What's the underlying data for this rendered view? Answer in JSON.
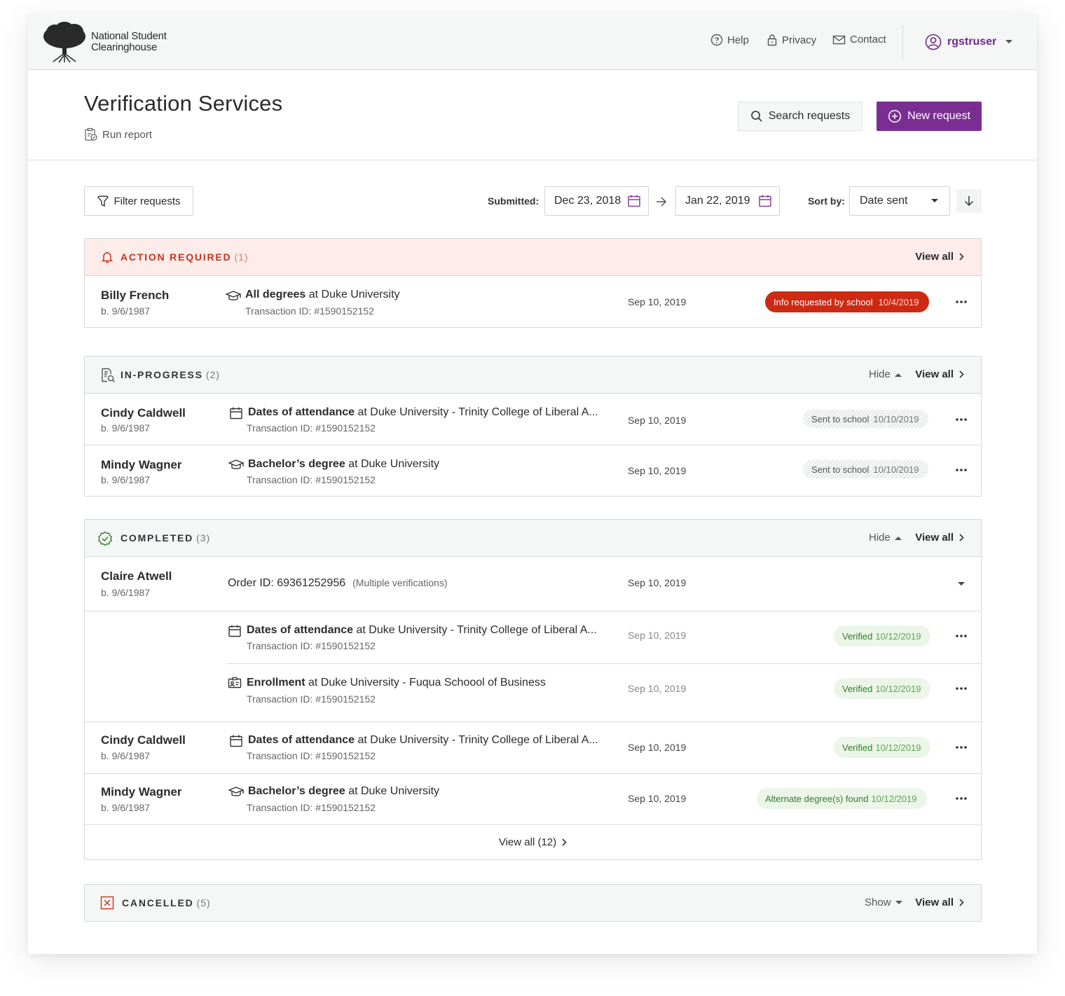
{
  "brand": {
    "name_line1": "National Student",
    "name_line2": "Clearinghouse"
  },
  "nav": {
    "help": "Help",
    "privacy": "Privacy",
    "contact": "Contact",
    "username": "rgstruser"
  },
  "page": {
    "title": "Verification Services",
    "run_report": "Run report",
    "search_button": "Search requests",
    "new_button": "New request"
  },
  "filters": {
    "filter_button": "Filter requests",
    "submitted_label": "Submitted:",
    "date_from": "Dec 23, 2018",
    "date_to": "Jan 22, 2019",
    "sort_label": "Sort by:",
    "sort_value": "Date sent"
  },
  "colors": {
    "brand_purple": "#7b2e91",
    "alert_red": "#cc2a12",
    "verified_green": "#2f7d2a"
  },
  "sections": {
    "action": {
      "title": "ACTION REQUIRED",
      "count": "(1)",
      "view_all": "View all",
      "rows": [
        {
          "name": "Billy French",
          "dob": "b. 9/6/1987",
          "icon": "graduation-cap-icon",
          "type": "All degrees",
          "at": "at Duke University",
          "transaction": "Transaction ID: #1590152152",
          "date": "Sep 10, 2019",
          "status": "Info requested by school",
          "status_date": "10/4/2019"
        }
      ]
    },
    "inprogress": {
      "title": "IN-PROGRESS",
      "count": "(2)",
      "hide": "Hide",
      "view_all": "View all",
      "rows": [
        {
          "name": "Cindy Caldwell",
          "dob": "b. 9/6/1987",
          "icon": "calendar-icon",
          "type": "Dates of attendance",
          "at": "at Duke University - Trinity College of Liberal A...",
          "transaction": "Transaction ID: #1590152152",
          "date": "Sep 10, 2019",
          "status": "Sent to school",
          "status_date": "10/10/2019"
        },
        {
          "name": "Mindy Wagner",
          "dob": "b. 9/6/1987",
          "icon": "graduation-cap-icon",
          "type": "Bachelor’s degree",
          "at": "at Duke University",
          "transaction": "Transaction ID: #1590152152",
          "date": "Sep 10, 2019",
          "status": "Sent to school",
          "status_date": "10/10/2019"
        }
      ]
    },
    "completed": {
      "title": "COMPLETED",
      "count": "(3)",
      "hide": "Hide",
      "view_all": "View all",
      "order": {
        "name": "Claire Atwell",
        "dob": "b. 9/6/1987",
        "order_id": "Order ID: 69361252956",
        "note": "(Multiple verifications)",
        "date": "Sep 10, 2019"
      },
      "sub_rows": [
        {
          "icon": "calendar-icon",
          "type": "Dates of attendance",
          "at": "at Duke University - Trinity College of Liberal A...",
          "transaction": "Transaction ID: #1590152152",
          "date": "Sep 10, 2019",
          "status": "Verified",
          "status_date": "10/12/2019"
        },
        {
          "icon": "id-card-icon",
          "type": "Enrollment",
          "at": "at Duke University - Fuqua Schoool of Business",
          "transaction": "Transaction ID: #1590152152",
          "date": "Sep 10, 2019",
          "status": "Verified",
          "status_date": "10/12/2019"
        }
      ],
      "rows": [
        {
          "name": "Cindy Caldwell",
          "dob": "b. 9/6/1987",
          "icon": "calendar-icon",
          "type": "Dates of attendance",
          "at": "at Duke University - Trinity College of Liberal A...",
          "transaction": "Transaction ID: #1590152152",
          "date": "Sep 10, 2019",
          "status": "Verified",
          "status_date": "10/12/2019"
        },
        {
          "name": "Mindy Wagner",
          "dob": "b. 9/6/1987",
          "icon": "graduation-cap-icon",
          "type": "Bachelor’s degree",
          "at": "at Duke University",
          "transaction": "Transaction ID: #1590152152",
          "date": "Sep 10, 2019",
          "status": "Alternate degree(s) found",
          "status_date": "10/12/2019"
        }
      ],
      "footer_view_all": "View all (12)"
    },
    "cancelled": {
      "title": "CANCELLED",
      "count": "(5)",
      "show": "Show",
      "view_all": "View all"
    }
  }
}
